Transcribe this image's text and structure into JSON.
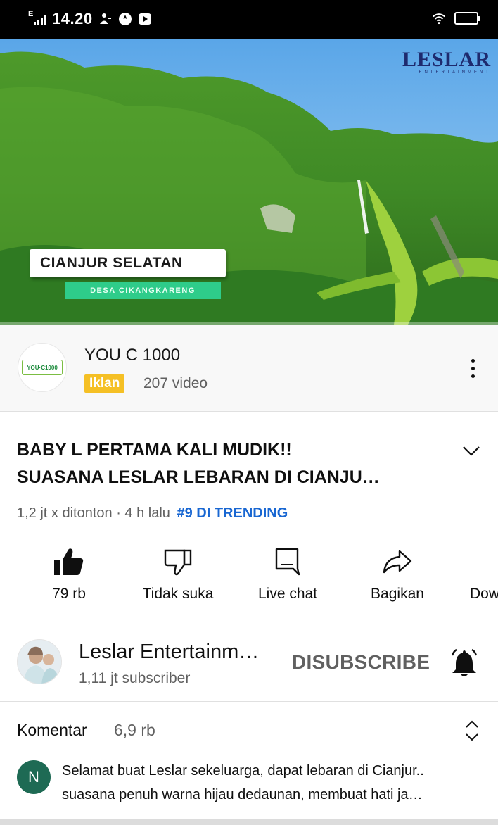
{
  "status_bar": {
    "time": "14.20",
    "network": "E",
    "battery": "57",
    "battery_level": 0.57,
    "icons": [
      "signal-icon",
      "notification-icon",
      "compass-icon",
      "youtube-icon",
      "wifi-icon",
      "battery-icon"
    ]
  },
  "video": {
    "logo_text": "LESLAR",
    "logo_sub": "ENTERTAINMENT",
    "location_title": "CIANJUR SELATAN",
    "location_sub": "DESA CIKANGKARENG"
  },
  "ad": {
    "logo_text": "YOU·C1000",
    "title": "YOU C 1000",
    "badge": "Iklan",
    "video_count": "207 video"
  },
  "video_info": {
    "title_line1": "BABY L PERTAMA KALI MUDIK!!",
    "title_line2": "SUASANA LESLAR LEBARAN DI CIANJU…",
    "views_time": "1,2 jt x ditonton · 4 h lalu",
    "trending": "#9 DI TRENDING"
  },
  "actions": {
    "like": "79 rb",
    "dislike": "Tidak suka",
    "live_chat": "Live chat",
    "share": "Bagikan",
    "download": "Dow"
  },
  "channel": {
    "name": "Leslar Entertainm…",
    "subscribers": "1,11 jt subscriber",
    "subscribe_state": "DISUBSCRIBE"
  },
  "comments": {
    "label": "Komentar",
    "count": "6,9 rb",
    "first": {
      "avatar_letter": "N",
      "line1": "Selamat buat Leslar sekeluarga, dapat lebaran di Cianjur..",
      "line2": "suasana penuh warna hijau dedaunan, membuat hati ja…"
    }
  },
  "colors": {
    "trending": "#1967d2",
    "ad_badge": "#f5c025",
    "comment_avatar": "#1e6a54",
    "location_sub_bg": "#2ecc8a"
  }
}
